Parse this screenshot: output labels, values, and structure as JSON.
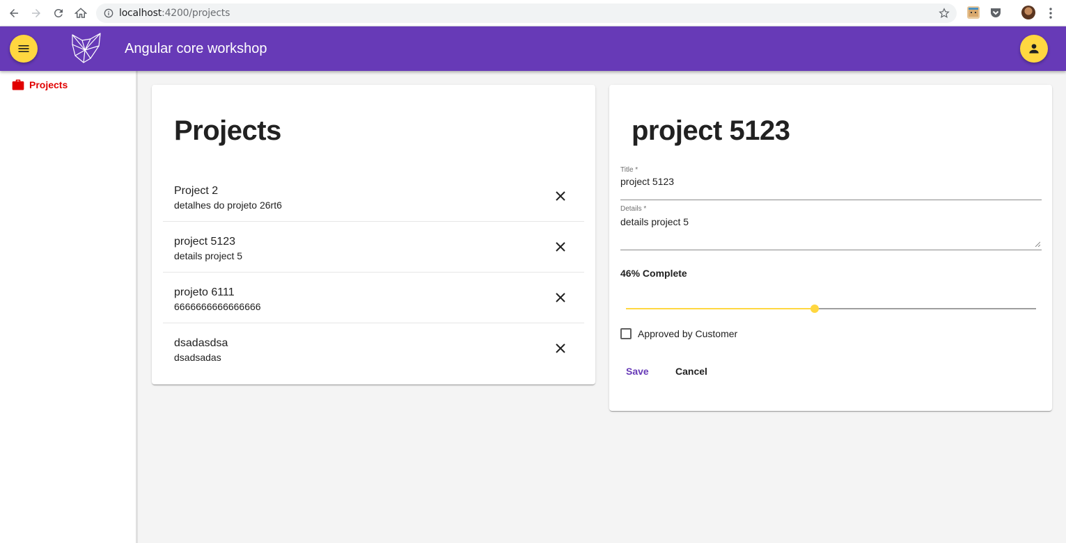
{
  "browser": {
    "url_host": "localhost",
    "url_path": ":4200/projects"
  },
  "toolbar": {
    "title": "Angular core workshop"
  },
  "sidebar": {
    "items": [
      {
        "label": "Projects"
      }
    ]
  },
  "projects_list": {
    "heading": "Projects",
    "items": [
      {
        "title": "Project 2",
        "details": "detalhes do projeto 26rt6"
      },
      {
        "title": "project 5123",
        "details": "details project 5"
      },
      {
        "title": "projeto 6111",
        "details": "6666666666666666"
      },
      {
        "title": "dsadasdsa",
        "details": "dsadsadas"
      }
    ]
  },
  "detail": {
    "heading": "project 5123",
    "title_label": "Title *",
    "title_value": "project 5123",
    "details_label": "Details *",
    "details_value": "details project 5",
    "complete_text": "46% Complete",
    "percent_complete": 46,
    "approved_label": "Approved by Customer",
    "approved": false,
    "save_label": "Save",
    "cancel_label": "Cancel"
  },
  "colors": {
    "primary": "#673ab7",
    "accent": "#ffd740",
    "sidebar_active": "#e10000"
  },
  "icons": {
    "menu": "menu-icon",
    "user": "account-icon",
    "delete": "close-icon",
    "briefcase": "briefcase-icon"
  }
}
